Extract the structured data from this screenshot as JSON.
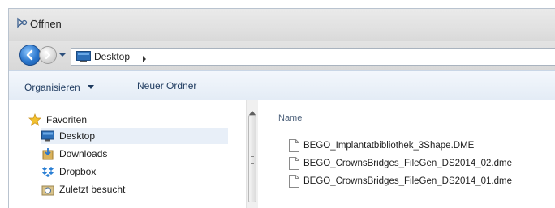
{
  "window": {
    "title": "Öffnen"
  },
  "address": {
    "location": "Desktop"
  },
  "toolbar": {
    "organize_label": "Organisieren",
    "new_folder_label": "Neuer Ordner"
  },
  "navigation": {
    "items": [
      {
        "label": "Favoriten",
        "icon": "star-icon"
      },
      {
        "label": "Desktop",
        "icon": "desktop-icon",
        "selected": true
      },
      {
        "label": "Downloads",
        "icon": "downloads-icon"
      },
      {
        "label": "Dropbox",
        "icon": "dropbox-icon"
      },
      {
        "label": "Zuletzt besucht",
        "icon": "recent-places-icon"
      }
    ]
  },
  "content": {
    "column_header": "Name",
    "files": [
      {
        "name": "BEGO_Implantatbibliothek_3Shape.DME",
        "icon": "document-icon"
      },
      {
        "name": "BEGO_CrownsBridges_FileGen_DS2014_02.dme",
        "icon": "document-icon"
      },
      {
        "name": "BEGO_CrownsBridges_FileGen_DS2014_01.dme",
        "icon": "document-icon"
      }
    ]
  },
  "colors": {
    "accent": "#2a76cc",
    "selection": "#e8eff8",
    "toolbar_text": "#1e3a5f"
  }
}
